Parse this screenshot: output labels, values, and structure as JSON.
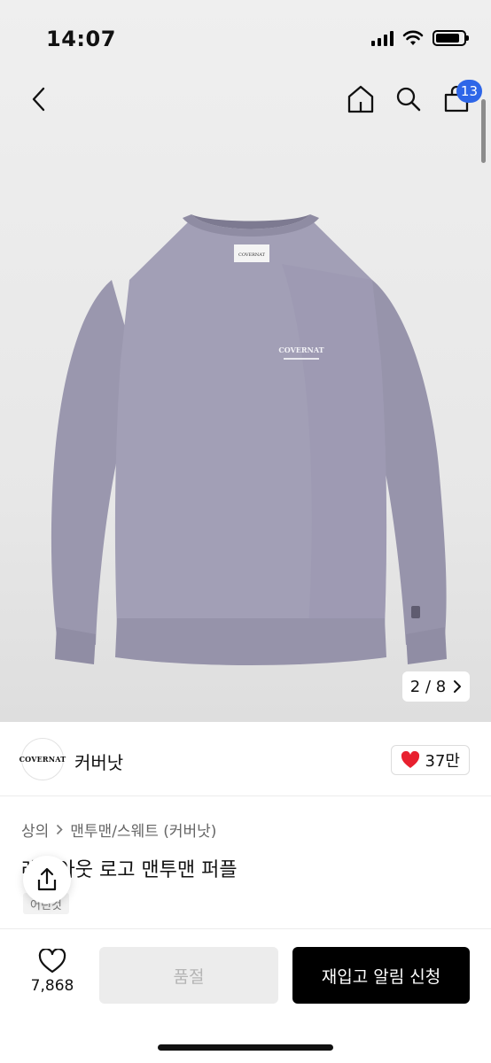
{
  "status_bar": {
    "time": "14:07"
  },
  "nav": {
    "cart_count": "13"
  },
  "gallery": {
    "current": "2",
    "separator": "/",
    "total": "8"
  },
  "brand": {
    "logo_text": "COVERNAT",
    "name": "커버낫",
    "likes": "37만"
  },
  "product": {
    "breadcrumb": [
      "상의",
      "맨투맨/스웨트 (커버낫)"
    ],
    "title": "레이아웃 로고 맨투맨 퍼플",
    "tag": "어린것"
  },
  "product_image": {
    "chest_logo": "COVERNAT",
    "neck_label": "COVERNAT"
  },
  "bottom_bar": {
    "wish_count": "7,868",
    "soldout_label": "품절",
    "notify_label": "재입고 알림 신청"
  },
  "colors": {
    "accent_blue": "#2e66e8",
    "heart_red": "#e8202f",
    "garment_purple": "#a29fb6"
  },
  "icons": [
    "chevron-left-icon",
    "home-icon",
    "search-icon",
    "cart-icon",
    "chevron-right-icon",
    "heart-icon",
    "share-icon",
    "heart-outline-icon"
  ]
}
